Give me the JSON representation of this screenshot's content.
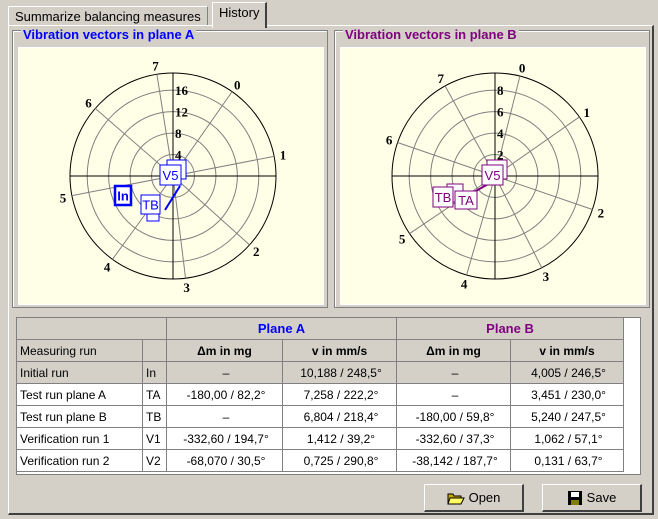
{
  "tabs": [
    {
      "label": "Summarize balancing measures",
      "active": false
    },
    {
      "label": "History",
      "active": true
    }
  ],
  "plane_a": {
    "title": "Vibration vectors in plane A",
    "color": "#0000ff",
    "ring_labels": [
      "4",
      "8",
      "12",
      "16"
    ],
    "spoke_labels": [
      "0",
      "1",
      "2",
      "3",
      "4",
      "5",
      "6",
      "7"
    ],
    "markers": [
      "In",
      "TB",
      "V5"
    ]
  },
  "plane_b": {
    "title": "Vibration vectors in plane B",
    "color": "#800080",
    "ring_labels": [
      "2",
      "4",
      "6",
      "8"
    ],
    "spoke_labels": [
      "0",
      "1",
      "2",
      "3",
      "4",
      "5",
      "6",
      "7"
    ],
    "markers": [
      "TB",
      "TA",
      "V5"
    ]
  },
  "table": {
    "group_headers": [
      "Plane A",
      "Plane B"
    ],
    "columns": [
      "Measuring run",
      "",
      "Δm in mg",
      "v in mm/s",
      "Δm in mg",
      "v in mm/s"
    ],
    "rows": [
      [
        "Initial run",
        "In",
        "–",
        "10,188 / 248,5°",
        "–",
        "4,005 / 246,5°"
      ],
      [
        "Test run plane A",
        "TA",
        "-180,00 / 82,2°",
        "7,258 / 222,2°",
        "–",
        "3,451 / 230,0°"
      ],
      [
        "Test run plane B",
        "TB",
        "–",
        "6,804 / 218,4°",
        "-180,00 / 59,8°",
        "5,240 / 247,5°"
      ],
      [
        "Verification run 1",
        "V1",
        "-332,60 / 194,7°",
        "1,412 / 39,2°",
        "-332,60 / 37,3°",
        "1,062 / 57,1°"
      ],
      [
        "Verification run 2",
        "V2",
        "-68,070 / 30,5°",
        "0,725 / 290,8°",
        "-38,142 / 187,7°",
        "0,131 / 63,7°"
      ]
    ]
  },
  "buttons": {
    "open": "Open",
    "save": "Save"
  }
}
